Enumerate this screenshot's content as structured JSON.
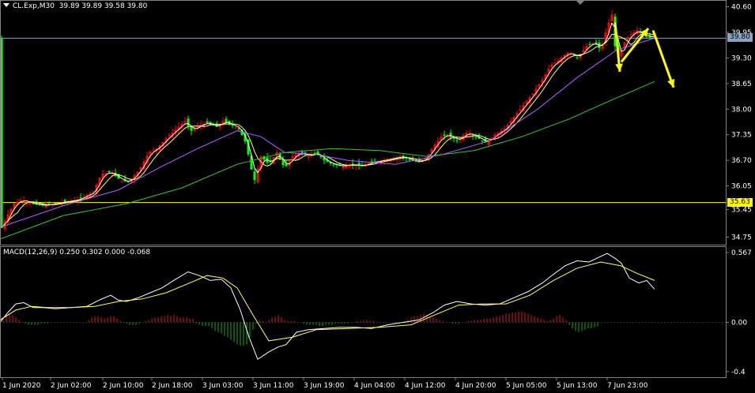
{
  "header": {
    "symbol": "CL.Exp,M30",
    "ohlc": "39.89 39.89 39.58 39.80"
  },
  "macd_header": "MACD(12,26,9) 0.250 0.302 0.000 -0.068",
  "current_price_label": "39.80",
  "support_label": "35.63",
  "colors": {
    "background": "#000000",
    "bull_candle": "#ff0000",
    "bear_candle": "#00ff00",
    "ma_fast": "#ffffff",
    "ma_mid": "#ffff80",
    "ma_slow1": "#b060ff",
    "ma_slow2": "#40c040",
    "arrows": "#ffff00",
    "macd_main": "#ffffff",
    "macd_signal": "#ffff66",
    "hist_pos": "#d02020",
    "hist_neg": "#20a020"
  },
  "chart_data": [
    {
      "type": "candlestick",
      "title": "CL.Exp,M30",
      "ylim": [
        34.6,
        40.65
      ],
      "yticks": [
        "40.60",
        "39.95",
        "39.30",
        "38.65",
        "38.00",
        "37.35",
        "36.70",
        "36.05",
        "35.45",
        "34.75"
      ],
      "ytick_values": [
        40.6,
        39.95,
        39.3,
        38.65,
        38.0,
        37.35,
        36.7,
        36.05,
        35.45,
        34.75
      ],
      "xticks": [
        "1 Jun 2020",
        "2 Jun 02:00",
        "2 Jun 10:00",
        "2 Jun 18:00",
        "3 Jun 03:00",
        "3 Jun 11:00",
        "3 Jun 19:00",
        "4 Jun 04:00",
        "4 Jun 12:00",
        "4 Jun 20:00",
        "5 Jun 05:00",
        "5 Jun 13:00",
        "7 Jun 23:00"
      ],
      "price_path_x": [
        0,
        9,
        18,
        27,
        40,
        56,
        68,
        82,
        98,
        118,
        128,
        140,
        152,
        162,
        176,
        188,
        198,
        212,
        226,
        234,
        242,
        252,
        262,
        274,
        282,
        292,
        302,
        312,
        316,
        322,
        330,
        340,
        350,
        360,
        370,
        380,
        390,
        400,
        410,
        420,
        432,
        444,
        456,
        470,
        484,
        496,
        508,
        520,
        532,
        540,
        550,
        558,
        566,
        578,
        590,
        602,
        614,
        626,
        638,
        650,
        662,
        674,
        686,
        696,
        704,
        712,
        720,
        730,
        742,
        752,
        760,
        768,
        774,
        780,
        786,
        792,
        798,
        806,
        814,
        820,
        826,
        832,
        155
      ],
      "price_path_y": [
        34.9,
        35.3,
        35.6,
        35.7,
        35.6,
        35.55,
        35.6,
        35.65,
        35.7,
        35.9,
        36.35,
        36.4,
        36.2,
        36.15,
        36.45,
        36.9,
        37.0,
        37.3,
        37.55,
        37.7,
        37.45,
        37.6,
        37.65,
        37.55,
        37.7,
        37.6,
        37.5,
        37.1,
        36.6,
        36.2,
        36.8,
        36.6,
        36.9,
        36.5,
        36.8,
        36.9,
        36.8,
        36.9,
        36.7,
        36.6,
        36.55,
        36.6,
        36.55,
        36.65,
        36.7,
        36.75,
        36.8,
        36.7,
        36.65,
        36.8,
        37.1,
        37.3,
        37.35,
        37.2,
        37.4,
        37.3,
        37.15,
        37.35,
        37.5,
        37.8,
        38.1,
        38.4,
        38.75,
        39.1,
        39.2,
        39.35,
        39.45,
        39.3,
        39.6,
        39.7,
        39.5,
        40.1,
        40.4,
        39.2,
        39.5,
        39.8,
        39.9,
        40.0,
        39.9,
        39.8,
        39.85,
        39.8,
        0
      ],
      "ma_slow2": [
        [
          0,
          34.7
        ],
        [
          80,
          35.3
        ],
        [
          160,
          35.6
        ],
        [
          230,
          36.0
        ],
        [
          300,
          36.6
        ],
        [
          360,
          36.9
        ],
        [
          420,
          37.0
        ],
        [
          480,
          36.95
        ],
        [
          540,
          36.8
        ],
        [
          600,
          36.95
        ],
        [
          660,
          37.3
        ],
        [
          720,
          37.75
        ],
        [
          770,
          38.2
        ],
        [
          828,
          38.7
        ]
      ],
      "ma_slow1": [
        [
          0,
          35.0
        ],
        [
          80,
          35.55
        ],
        [
          150,
          35.95
        ],
        [
          200,
          36.5
        ],
        [
          250,
          37.0
        ],
        [
          300,
          37.45
        ],
        [
          330,
          37.3
        ],
        [
          360,
          36.9
        ],
        [
          400,
          36.85
        ],
        [
          440,
          36.7
        ],
        [
          500,
          36.6
        ],
        [
          560,
          36.85
        ],
        [
          620,
          37.2
        ],
        [
          680,
          38.0
        ],
        [
          730,
          38.8
        ],
        [
          780,
          39.5
        ],
        [
          828,
          39.8
        ]
      ],
      "series_labels": [],
      "horizontal_lines": [
        {
          "value": 35.63,
          "label": "35.63",
          "color": "#ffff00"
        },
        {
          "value": 39.8,
          "label": "39.80",
          "color": "#8aa4c0"
        }
      ]
    },
    {
      "type": "macd",
      "title": "MACD(12,26,9) 0.250 0.302 0.000 -0.068",
      "ylim": [
        -0.42,
        0.58
      ],
      "yticks": [
        "0.567",
        "0.00",
        "-0.4"
      ],
      "ytick_values": [
        0.567,
        0.0,
        -0.4
      ],
      "main_x": [
        0,
        10,
        20,
        30,
        42,
        55,
        70,
        90,
        110,
        125,
        140,
        150,
        160,
        175,
        190,
        205,
        222,
        238,
        252,
        266,
        280,
        292,
        304,
        315,
        326,
        340,
        352,
        362,
        375,
        390,
        410,
        430,
        450,
        470,
        490,
        510,
        530,
        548,
        562,
        578,
        596,
        614,
        632,
        650,
        668,
        686,
        700,
        715,
        730,
        745,
        758,
        768,
        778,
        786,
        796,
        808,
        818,
        828
      ],
      "main_y": [
        0.0,
        0.08,
        0.15,
        0.16,
        0.12,
        0.12,
        0.11,
        0.12,
        0.13,
        0.18,
        0.22,
        0.18,
        0.17,
        0.2,
        0.24,
        0.28,
        0.35,
        0.41,
        0.38,
        0.34,
        0.35,
        0.28,
        0.1,
        -0.12,
        -0.3,
        -0.24,
        -0.2,
        -0.18,
        -0.08,
        -0.06,
        -0.05,
        -0.04,
        -0.04,
        -0.05,
        -0.02,
        0.0,
        0.02,
        0.08,
        0.14,
        0.17,
        0.15,
        0.14,
        0.15,
        0.2,
        0.25,
        0.32,
        0.39,
        0.46,
        0.5,
        0.49,
        0.53,
        0.56,
        0.52,
        0.48,
        0.36,
        0.32,
        0.34,
        0.27
      ],
      "signal_x": [
        0,
        20,
        40,
        60,
        90,
        120,
        150,
        180,
        210,
        240,
        262,
        282,
        300,
        320,
        340,
        370,
        400,
        440,
        480,
        520,
        550,
        580,
        610,
        640,
        670,
        700,
        730,
        760,
        785,
        805,
        828
      ],
      "signal_y": [
        0.02,
        0.1,
        0.13,
        0.12,
        0.12,
        0.13,
        0.17,
        0.19,
        0.24,
        0.32,
        0.38,
        0.36,
        0.28,
        0.06,
        -0.15,
        -0.12,
        -0.06,
        -0.05,
        -0.04,
        -0.02,
        0.06,
        0.14,
        0.15,
        0.15,
        0.22,
        0.34,
        0.44,
        0.49,
        0.46,
        0.4,
        0.34
      ],
      "histogram_x_start": 4,
      "histogram_step": 4,
      "histogram": [
        0.02,
        0.06,
        0.07,
        0.06,
        0.04,
        0.02,
        0.0,
        -0.01,
        -0.02,
        -0.02,
        -0.02,
        -0.02,
        -0.01,
        -0.01,
        -0.01,
        0.0,
        0.0,
        0.0,
        0.0,
        0.0,
        0.0,
        0.0,
        0.0,
        0.0,
        0.0,
        0.0,
        0.0,
        0.02,
        0.04,
        0.05,
        0.05,
        0.04,
        0.03,
        0.04,
        0.05,
        0.05,
        0.03,
        0.01,
        0.0,
        -0.01,
        -0.02,
        -0.02,
        -0.02,
        -0.01,
        0.0,
        0.01,
        0.02,
        0.03,
        0.04,
        0.04,
        0.05,
        0.05,
        0.06,
        0.05,
        0.06,
        0.05,
        0.04,
        0.04,
        0.04,
        0.03,
        0.03,
        -0.01,
        -0.02,
        -0.03,
        -0.03,
        -0.03,
        -0.05,
        -0.07,
        -0.08,
        -0.09,
        -0.11,
        -0.12,
        -0.14,
        -0.16,
        -0.18,
        -0.19,
        -0.19,
        -0.18,
        -0.12,
        -0.06,
        -0.01,
        0.02,
        0.01,
        0.0,
        0.02,
        0.04,
        0.05,
        0.06,
        0.04,
        0.02,
        0.01,
        0.01,
        0.01,
        0.0,
        0.0,
        -0.01,
        -0.02,
        -0.02,
        -0.02,
        -0.02,
        -0.03,
        -0.03,
        -0.02,
        -0.02,
        -0.02,
        -0.01,
        -0.01,
        -0.01,
        -0.01,
        -0.01,
        0.0,
        0.0,
        0.01,
        0.01,
        0.02,
        0.02,
        0.01,
        0.01,
        0.0,
        0.0,
        0.0,
        0.0,
        0.0,
        0.0,
        -0.01,
        -0.01,
        0.0,
        0.01,
        0.02,
        0.04,
        0.05,
        0.05,
        0.06,
        0.07,
        0.06,
        0.05,
        0.04,
        0.03,
        0.02,
        0.01,
        0.0,
        0.0,
        -0.01,
        -0.01,
        -0.01,
        0.0,
        0.0,
        0.01,
        0.01,
        0.02,
        0.02,
        0.02,
        0.03,
        0.03,
        0.03,
        0.04,
        0.05,
        0.05,
        0.06,
        0.07,
        0.07,
        0.08,
        0.08,
        0.09,
        0.09,
        0.08,
        0.07,
        0.06,
        0.05,
        0.04,
        0.03,
        0.02,
        0.01,
        0.02,
        0.03,
        0.05,
        0.06,
        0.04,
        0.02,
        -0.02,
        -0.05,
        -0.07,
        -0.08,
        -0.07,
        -0.06,
        -0.05,
        -0.05,
        -0.04,
        -0.03
      ],
      "series_labels": []
    }
  ]
}
